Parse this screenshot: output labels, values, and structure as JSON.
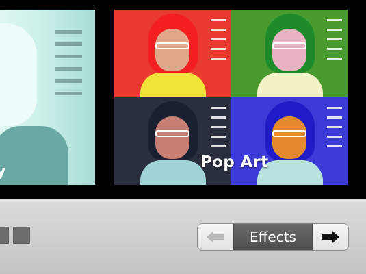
{
  "viewer": {
    "left_tile_label": "y",
    "selected_effect_label": "Pop Art"
  },
  "toolbar": {
    "effects_label": "Effects",
    "prev_icon": "arrow-left-icon",
    "next_icon": "arrow-right-icon"
  },
  "colors": {
    "pop_red": "#e83a2e",
    "pop_green": "#4a9b2f",
    "pop_dark": "#2a2f3d",
    "pop_blue": "#3d3bd8",
    "toolbar_bg": "#d0d0d0",
    "effects_button_bg": "#5b5b5b"
  }
}
